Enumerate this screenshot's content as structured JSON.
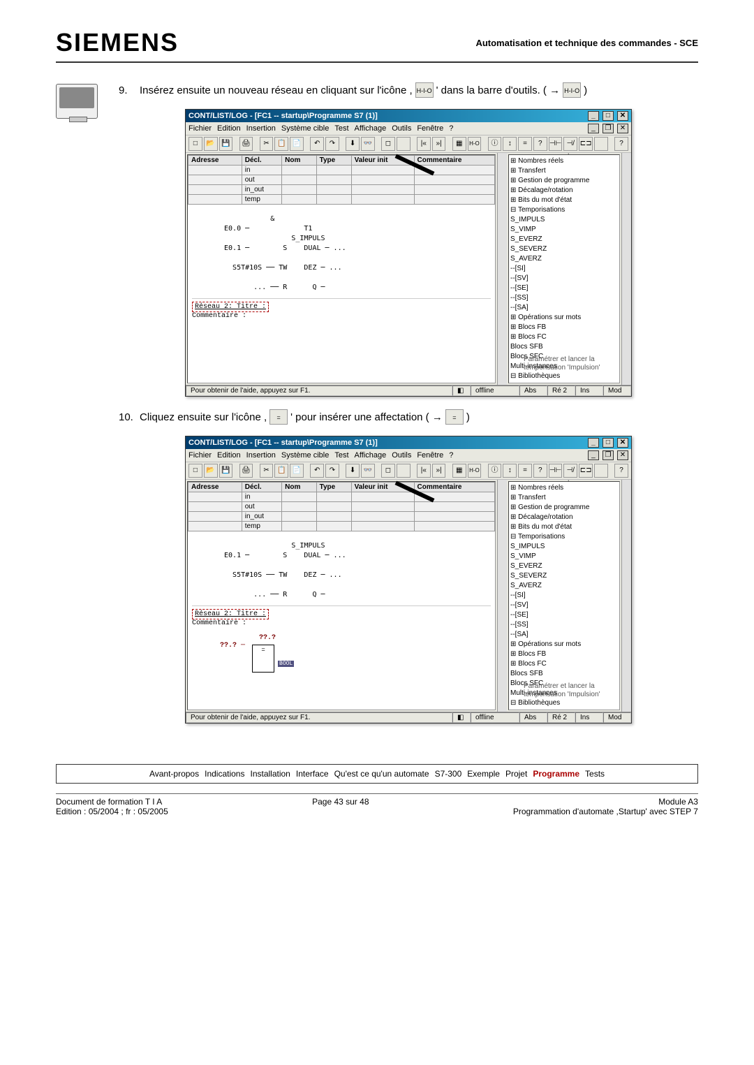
{
  "header": {
    "logo_text": "SIEMENS",
    "right_text": "Automatisation et technique des commandes - SCE"
  },
  "step9": {
    "number": "9.",
    "text_before": "Insérez ensuite un nouveau réseau en cliquant sur l'icône ,",
    "text_after": "' dans la barre d'outils. ( →",
    "text_end": ")",
    "icon_top": "H-I-O"
  },
  "step10": {
    "number": "10.",
    "text_before": "Cliquez ensuite sur l'icône ,",
    "text_after": "' pour insérer une affectation ( →",
    "text_end": ")",
    "icon_eq": "="
  },
  "win": {
    "title": "CONT/LIST/LOG - [FC1 -- startup\\Programme S7 (1)]",
    "menu": [
      "Fichier",
      "Edition",
      "Insertion",
      "Système cible",
      "Test",
      "Affichage",
      "Outils",
      "Fenêtre",
      "?"
    ],
    "decl_headers": [
      "Adresse",
      "Décl.",
      "Nom",
      "Type",
      "Valeur init",
      "Commentaire"
    ],
    "decl_rows": [
      "in",
      "out",
      "in_out",
      "temp"
    ],
    "ladder1": "            &\n E0.0 ─             T1\n                 S_IMPULS\n E0.1 ─        S    DUAL ─ ...\n\n   S5T#10S ── TW    DEZ ─ ...\n\n        ... ── R      Q ─",
    "network_title": "Réseau   2: Titre :",
    "comment_label": "Commentaire :",
    "ladder2": "                 S_IMPULS\n E0.1 ─        S    DUAL ─ ...\n\n   S5T#10S ── TW    DEZ ─ ...\n\n        ... ── R      Q ─",
    "affect_top": "??.?",
    "affect_left": "??.? ─",
    "tree": [
      "⊞ Nombres réels",
      "⊞ Transfert",
      "⊞ Gestion de programme",
      "⊞ Décalage/rotation",
      "⊞ Bits du mot d'état",
      "⊟ Temporisations",
      "   S_IMPULS",
      "   S_VIMP",
      "   S_EVERZ",
      "   S_SEVERZ",
      "   S_AVERZ",
      "   --[SI]",
      "   --[SV]",
      "   --[SE]",
      "   --[SS]",
      "   --[SA]",
      "⊞ Opérations sur mots",
      "⊞ Blocs FB",
      "⊞ Blocs FC",
      "   Blocs SFB",
      "   Blocs SFC",
      "   Multi-instances",
      "⊟ Bibliothèques"
    ],
    "side_desc": "Paramétrer et lancer la temporisation 'Impulsion'",
    "status_help": "Pour obtenir de l'aide, appuyez sur F1.",
    "status_offline": "offline",
    "status_abs": "Abs",
    "status_re": "Ré 2",
    "status_ins": "Ins",
    "status_mod": "Mod"
  },
  "nav": {
    "items": [
      "Avant-propos",
      "Indications",
      "Installation",
      "Interface",
      "Qu'est ce qu'un automate",
      "S7-300",
      "Exemple",
      "Projet",
      "Programme",
      "Tests"
    ],
    "highlight_index": 8
  },
  "footer": {
    "left_l1": "Document de formation T I A",
    "left_l2": "Edition : 05/2004 ; fr : 05/2005",
    "center": "Page 43 sur 48",
    "right_l1": "Module A3",
    "right_l2": "Programmation d'automate ,Startup' avec STEP 7"
  }
}
